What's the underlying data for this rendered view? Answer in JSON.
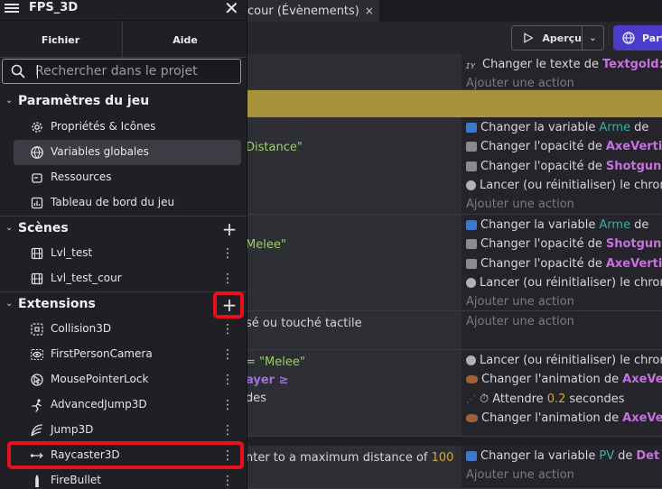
{
  "editor": {
    "tab_label": "cour (Évènements)",
    "tab_close": "×",
    "preview_label": "Aperçu",
    "publish_label": "Part",
    "events": [
      {
        "cond": "",
        "actions": [
          {
            "icon": "text-icon",
            "parts": [
              [
                "Changer le texte de ",
                ""
              ],
              [
                "Textgold:",
                "obj"
              ]
            ]
          },
          {
            "add": true,
            "text": "Ajouter une action"
          }
        ]
      },
      {
        "cond": "Distance\"",
        "actions": [
          {
            "icon": "variable-icon",
            "parts": [
              [
                "Changer la variable ",
                ""
              ],
              [
                "Arme",
                "var"
              ],
              [
                " de ",
                ""
              ]
            ]
          },
          {
            "icon": "opacity-icon",
            "parts": [
              [
                "Changer l'opacité de ",
                ""
              ],
              [
                "AxeVerti",
                "obj"
              ]
            ]
          },
          {
            "icon": "opacity-icon",
            "parts": [
              [
                "Changer l'opacité de ",
                ""
              ],
              [
                "Shotgun",
                "obj"
              ]
            ]
          },
          {
            "icon": "timer-icon",
            "parts": [
              [
                "Lancer (ou réinitialiser) le chrono",
                ""
              ]
            ]
          },
          {
            "add": true,
            "text": "Ajouter une action"
          }
        ]
      },
      {
        "cond": "Melee\"",
        "actions": [
          {
            "icon": "variable-icon",
            "parts": [
              [
                "Changer la variable ",
                ""
              ],
              [
                "Arme",
                "var"
              ],
              [
                " de ",
                ""
              ]
            ]
          },
          {
            "icon": "opacity-icon",
            "parts": [
              [
                "Changer l'opacité de ",
                ""
              ],
              [
                "Shotgun",
                "obj"
              ]
            ]
          },
          {
            "icon": "opacity-icon",
            "parts": [
              [
                "Changer l'opacité de ",
                ""
              ],
              [
                "AxeVerti",
                "obj"
              ]
            ]
          },
          {
            "icon": "timer-icon",
            "parts": [
              [
                "Lancer (ou réinitialiser) le chrono",
                ""
              ]
            ]
          },
          {
            "add": true,
            "text": "Ajouter une action"
          }
        ]
      },
      {
        "cond": "sé ou touché tactile",
        "actions": [
          {
            "add": true,
            "text": "Ajouter une action"
          }
        ]
      },
      {
        "cond_lines": [
          [
            "= ",
            "\"Melee\""
          ],
          [
            "ayer ≥",
            ""
          ],
          [
            "des",
            ""
          ]
        ],
        "actions": [
          {
            "icon": "timer-icon",
            "parts": [
              [
                "Lancer (ou réinitialiser) le chrono",
                ""
              ]
            ]
          },
          {
            "icon": "animation-icon",
            "parts": [
              [
                "Changer l'animation de ",
                ""
              ],
              [
                "AxeVe",
                "obj"
              ]
            ]
          },
          {
            "icon": "wait-icon",
            "parts": [
              [
                "⏱ Attendre ",
                ""
              ],
              [
                "0.2",
                "num"
              ],
              [
                " secondes",
                ""
              ]
            ]
          },
          {
            "icon": "animation-icon",
            "parts": [
              [
                "Changer l'animation de ",
                ""
              ],
              [
                "AxeVe",
                "obj"
              ]
            ]
          }
        ]
      },
      {
        "cond_parts": [
          [
            "nter to a maximum distance of ",
            ""
          ],
          [
            "100",
            "num"
          ]
        ],
        "actions": [
          {
            "icon": "variable-icon",
            "parts": [
              [
                "Changer la variable ",
                ""
              ],
              [
                "PV",
                "var"
              ],
              [
                " de ",
                ""
              ],
              [
                "Det",
                "obj"
              ]
            ]
          },
          {
            "add": true,
            "text": "Ajouter une action"
          }
        ]
      }
    ]
  },
  "drawer": {
    "project_title": "FPS_3D",
    "close_glyph": "✕",
    "menu": {
      "fichier": "Fichier",
      "aide": "Aide"
    },
    "search": {
      "placeholder": "Rechercher dans le projet",
      "value": ""
    },
    "sections": {
      "game_settings": {
        "title": "Paramètres du jeu",
        "items": [
          {
            "label": "Propriétés & Icônes",
            "icon": "gear-icon"
          },
          {
            "label": "Variables globales",
            "icon": "globe-icon",
            "selected": true
          },
          {
            "label": "Ressources",
            "icon": "resources-icon"
          },
          {
            "label": "Tableau de bord du jeu",
            "icon": "dashboard-icon"
          }
        ]
      },
      "scenes": {
        "title": "Scènes",
        "add_glyph": "+",
        "items": [
          {
            "label": "Lvl_test",
            "icon": "film-icon"
          },
          {
            "label": "Lvl_test_cour",
            "icon": "film-icon"
          }
        ]
      },
      "extensions": {
        "title": "Extensions",
        "add_glyph": "+",
        "items": [
          {
            "label": "Collision3D",
            "icon": "collision-icon"
          },
          {
            "label": "FirstPersonCamera",
            "icon": "eye-icon"
          },
          {
            "label": "MousePointerLock",
            "icon": "pointer-lock-icon"
          },
          {
            "label": "AdvancedJump3D",
            "icon": "jump-icon"
          },
          {
            "label": "Jump3D",
            "icon": "jump-arc-icon"
          },
          {
            "label": "Raycaster3D",
            "icon": "raycast-icon"
          },
          {
            "label": "FireBullet",
            "icon": "bullet-icon"
          }
        ]
      }
    },
    "kebab_glyph": "⋮",
    "chevron_glyph": "⌄"
  },
  "colors": {
    "accent_publish": "#4b3bc9",
    "highlight": "#e8101a",
    "object_name": "#c770e0",
    "variable_name": "#38b0a8",
    "number": "#d4a63a",
    "string": "#9ccf6a"
  }
}
